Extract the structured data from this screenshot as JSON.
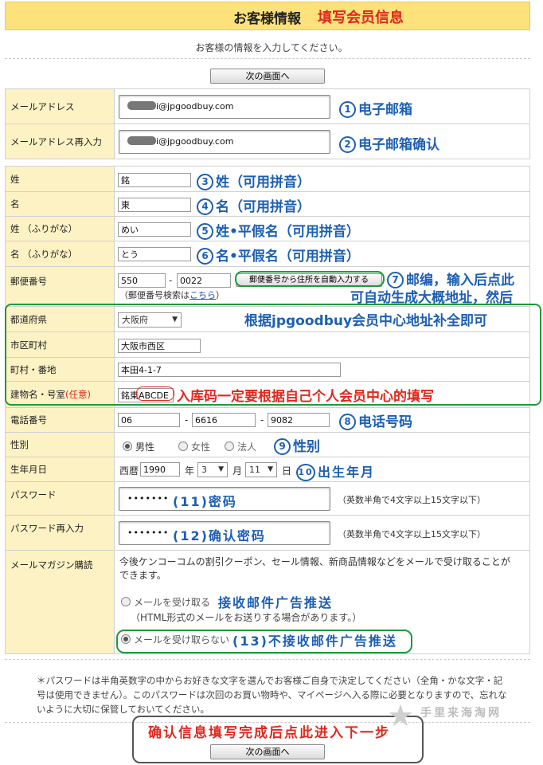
{
  "header": {
    "title_jp": "お客様情報",
    "title_cn": "填写会员信息"
  },
  "intro": "お客様の情報を入力してください。",
  "next_button": "次の画面へ",
  "fields": {
    "email": {
      "label": "メールアドレス",
      "value": "i@jpgoodbuy.com",
      "note": "电子邮箱",
      "num": "1"
    },
    "email_confirm": {
      "label": "メールアドレス再入力",
      "value": "i@jpgoodbuy.com",
      "note": "电子邮箱确认",
      "num": "2"
    },
    "last_name": {
      "label": "姓",
      "value": "銘",
      "note": "姓（可用拼音）",
      "num": "3"
    },
    "first_name": {
      "label": "名",
      "value": "東",
      "note": "名（可用拼音）",
      "num": "4"
    },
    "last_kana": {
      "label": "姓 （ふりがな）",
      "value": "めい",
      "note": "姓•平假名（可用拼音）",
      "num": "5"
    },
    "first_kana": {
      "label": "名 （ふりがな）",
      "value": "とう",
      "note": "名•平假名（可用拼音）",
      "num": "6"
    },
    "postal": {
      "label": "郵便番号",
      "value1": "550",
      "sep": "-",
      "value2": "0022",
      "auto_button": "郵便番号から住所を自動入力する",
      "search_prefix": "（郵便番号検索は",
      "search_link": "こちら",
      "search_suffix": "）",
      "note": "邮编，输入后点此",
      "note2": "可自动生成大概地址，然后",
      "num": "7"
    },
    "address_note": "根据jpgoodbuy会员中心地址补全即可",
    "prefecture": {
      "label": "都道府県",
      "value": "大阪府"
    },
    "city": {
      "label": "市区町村",
      "value": "大阪市西区"
    },
    "street": {
      "label": "町村・番地",
      "value": "本田4-1-7"
    },
    "building": {
      "label": "建物名・号室",
      "optional": "(任意)",
      "value_prefix": "銘東",
      "value_code": "ABCDE",
      "note": "入库码一定要根据自己个人会员中心的填写"
    },
    "phone": {
      "label": "電話番号",
      "v1": "06",
      "v2": "6616",
      "v3": "9082",
      "sep": "-",
      "note": "电话号码",
      "num": "8"
    },
    "gender": {
      "label": "性別",
      "options": [
        "男性",
        "女性",
        "法人"
      ],
      "selected": "男性",
      "note": "性别",
      "num": "9"
    },
    "birthday": {
      "label": "生年月日",
      "era": "西暦",
      "year": "1990",
      "year_unit": "年",
      "month": "3",
      "month_unit": "月",
      "day": "11",
      "day_unit": "日",
      "note": "出生年月",
      "num": "10"
    },
    "password": {
      "label": "パスワード",
      "value": "•••••••",
      "hint": "（英数半角で4文字以上15文字以下）",
      "note": "密码",
      "num": "(11)"
    },
    "password_confirm": {
      "label": "パスワード再入力",
      "value": "•••••••",
      "hint": "（英数半角で4文字以上15文字以下）",
      "note": "确认密码",
      "num": "(12)"
    },
    "newsletter": {
      "label": "メールマガジン購読",
      "desc": "今後ケンコーコムの割引クーポン、セール情報、新商品情報などをメールで受け取ることができます。",
      "opt_receive": "メールを受け取る",
      "opt_receive_note": "接收邮件广告推送",
      "opt_receive_sub": "（HTML形式のメールをお送りする場合があります。）",
      "opt_refuse": "メールを受け取らない",
      "opt_refuse_num": "(13)",
      "opt_refuse_note": "不接收邮件广告推送"
    }
  },
  "footer_note": "＊パスワードは半角英数字の中からお好きな文字を選んでお客様ご自身で決定してください（全角・かな文字・記号は使用できません）。このパスワードは次回のお買い物時や、マイページへ入る際に必要となりますので、忘れないように大切に保管しておいてください。",
  "confirm_note": "确认信息填写完成后点此进入下一步",
  "watermark": "手里来海淘网",
  "colors": {
    "accent_blue": "#1d5fb3",
    "accent_red": "#e0281d",
    "accent_green": "#1e9a3c",
    "label_bg": "#fdf2c4",
    "title_bg": "#fde27c"
  }
}
